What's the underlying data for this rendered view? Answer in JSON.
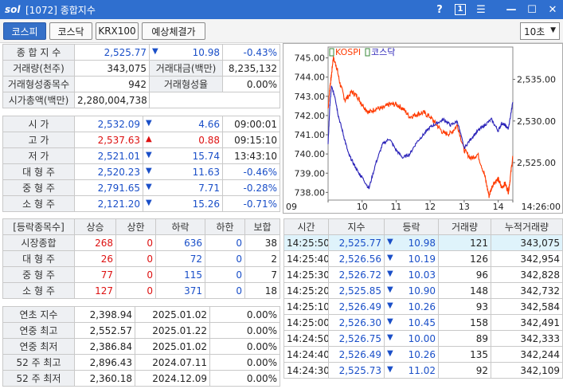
{
  "window": {
    "logo": "sol",
    "title": "[1072] 종합지수",
    "help": "?",
    "one": "1",
    "menu": "☰",
    "minimize": "—",
    "maximize": "☐",
    "close": "✕"
  },
  "toolbar": {
    "tabs": [
      "코스피",
      "코스닥",
      "KRX100",
      "예상체결가"
    ],
    "interval": "10초"
  },
  "summary": [
    {
      "c1": "종 합 지 수",
      "c2": "2,525.77",
      "c3": "▼",
      "c4": "10.98",
      "c5": "-0.43%"
    },
    {
      "c1": "거래량(천주)",
      "c2": "343,075",
      "c3": "거래대금(백만)",
      "c4": "8,235,132"
    },
    {
      "c1": "거래형성종목수",
      "c2": "942",
      "c3": "거래형성율",
      "c4": "0.00%"
    },
    {
      "c1": "시가총액(백만)",
      "c2": "2,280,004,738"
    }
  ],
  "prices": [
    {
      "label": "시      가",
      "value": "2,532.09",
      "dir": "▼",
      "change": "4.66",
      "extra": "09:00:01"
    },
    {
      "label": "고      가",
      "value": "2,537.63",
      "dir": "▲",
      "change": "0.88",
      "extra": "09:15:10"
    },
    {
      "label": "저      가",
      "value": "2,521.01",
      "dir": "▼",
      "change": "15.74",
      "extra": "13:43:10"
    },
    {
      "label": "대 형 주",
      "value": "2,520.23",
      "dir": "▼",
      "change": "11.63",
      "extra": "-0.46%"
    },
    {
      "label": "중 형 주",
      "value": "2,791.65",
      "dir": "▼",
      "change": "7.71",
      "extra": "-0.28%"
    },
    {
      "label": "소 형 주",
      "value": "2,121.20",
      "dir": "▼",
      "change": "15.26",
      "extra": "-0.71%"
    }
  ],
  "breadth": {
    "headers": [
      "[등락종목수]",
      "상승",
      "상한",
      "하락",
      "하한",
      "보합"
    ],
    "rows": [
      {
        "label": "시장종합",
        "up": "268",
        "limit_up": "0",
        "down": "636",
        "limit_down": "0",
        "flat": "38"
      },
      {
        "label": "대 형 주",
        "up": "26",
        "limit_up": "0",
        "down": "72",
        "limit_down": "0",
        "flat": "2"
      },
      {
        "label": "중 형 주",
        "up": "77",
        "limit_up": "0",
        "down": "115",
        "limit_down": "0",
        "flat": "7"
      },
      {
        "label": "소 형 주",
        "up": "127",
        "limit_up": "0",
        "down": "371",
        "limit_down": "0",
        "flat": "18"
      }
    ]
  },
  "extremes": [
    {
      "label": "연초  지수",
      "value": "2,398.94",
      "date": "2025.01.02",
      "pct": "0.00%"
    },
    {
      "label": "연중  최고",
      "value": "2,552.57",
      "date": "2025.01.22",
      "pct": "0.00%"
    },
    {
      "label": "연중  최저",
      "value": "2,386.84",
      "date": "2025.01.02",
      "pct": "0.00%"
    },
    {
      "label": "52 주 최고",
      "value": "2,896.43",
      "date": "2024.07.11",
      "pct": "0.00%"
    },
    {
      "label": "52 주 최저",
      "value": "2,360.18",
      "date": "2024.12.09",
      "pct": "0.00%"
    }
  ],
  "ticks": {
    "headers": [
      "시간",
      "지수",
      "등락",
      "거래량",
      "누적거래량"
    ],
    "rows": [
      {
        "time": "14:25:50",
        "index": "2,525.77",
        "dir": "▼",
        "change": "10.98",
        "vol": "121",
        "cum": "343,075"
      },
      {
        "time": "14:25:40",
        "index": "2,526.56",
        "dir": "▼",
        "change": "10.19",
        "vol": "126",
        "cum": "342,954"
      },
      {
        "time": "14:25:30",
        "index": "2,526.72",
        "dir": "▼",
        "change": "10.03",
        "vol": "96",
        "cum": "342,828"
      },
      {
        "time": "14:25:20",
        "index": "2,525.85",
        "dir": "▼",
        "change": "10.90",
        "vol": "148",
        "cum": "342,732"
      },
      {
        "time": "14:25:10",
        "index": "2,526.49",
        "dir": "▼",
        "change": "10.26",
        "vol": "93",
        "cum": "342,584"
      },
      {
        "time": "14:25:00",
        "index": "2,526.30",
        "dir": "▼",
        "change": "10.45",
        "vol": "158",
        "cum": "342,491"
      },
      {
        "time": "14:24:50",
        "index": "2,526.75",
        "dir": "▼",
        "change": "10.00",
        "vol": "89",
        "cum": "342,333"
      },
      {
        "time": "14:24:40",
        "index": "2,526.49",
        "dir": "▼",
        "change": "10.26",
        "vol": "135",
        "cum": "342,244"
      },
      {
        "time": "14:24:30",
        "index": "2,525.73",
        "dir": "▼",
        "change": "11.02",
        "vol": "92",
        "cum": "342,109"
      }
    ]
  },
  "colors": {
    "kospi": "#ff3a00",
    "kosdaq": "#2a22b8",
    "up": "#dd1111",
    "down": "#1a4fc8",
    "title_bar": "#2f6fcf"
  },
  "chart_data": {
    "type": "line",
    "legend": [
      "KOSPI",
      "코스닥"
    ],
    "legend_position": "top-left",
    "y_left_ticks": [
      "745.00",
      "744.00",
      "743.00",
      "742.00",
      "741.00",
      "740.00",
      "739.00",
      "738.00"
    ],
    "y_left_range": [
      737.6,
      745.4
    ],
    "y_right_ticks": [
      "2,535.00",
      "2,530.00",
      "2,525.00"
    ],
    "y_right_range": [
      2520.5,
      2538.5
    ],
    "x_ticks": [
      "09",
      "10",
      "11",
      "12",
      "13",
      "14",
      "14:26:00"
    ],
    "x_range": [
      9.0,
      14.43
    ],
    "series": [
      {
        "name": "KOSPI",
        "axis": "right",
        "x": [
          9.0,
          9.05,
          9.1,
          9.15,
          9.25,
          9.35,
          9.5,
          9.7,
          9.85,
          10.0,
          10.2,
          10.4,
          10.6,
          10.8,
          11.0,
          11.2,
          11.4,
          11.6,
          11.8,
          12.0,
          12.2,
          12.4,
          12.6,
          12.8,
          13.0,
          13.2,
          13.4,
          13.6,
          13.73,
          13.85,
          14.0,
          14.1,
          14.2,
          14.3,
          14.35,
          14.43
        ],
        "values": [
          2531.5,
          2534.0,
          2535.5,
          2537.6,
          2536.5,
          2534.5,
          2532.5,
          2533.5,
          2533.0,
          2532.0,
          2531.0,
          2531.5,
          2531.5,
          2532.0,
          2532.0,
          2531.5,
          2530.5,
          2530.8,
          2531.0,
          2530.5,
          2529.5,
          2528.5,
          2528.5,
          2529.5,
          2526.5,
          2525.5,
          2526.0,
          2523.5,
          2521.0,
          2522.5,
          2523.0,
          2522.0,
          2522.5,
          2521.5,
          2523.0,
          2525.8
        ]
      },
      {
        "name": "코스닥",
        "axis": "left",
        "x": [
          9.0,
          9.05,
          9.1,
          9.2,
          9.3,
          9.45,
          9.6,
          9.75,
          9.9,
          10.0,
          10.2,
          10.4,
          10.6,
          10.8,
          11.0,
          11.2,
          11.4,
          11.6,
          11.8,
          12.0,
          12.2,
          12.4,
          12.6,
          12.8,
          13.0,
          13.2,
          13.4,
          13.6,
          13.8,
          14.0,
          14.1,
          14.2,
          14.3,
          14.43
        ],
        "values": [
          740.5,
          742.5,
          743.5,
          743.0,
          742.0,
          741.0,
          740.0,
          739.5,
          739.0,
          738.8,
          738.2,
          739.5,
          740.5,
          740.8,
          740.2,
          739.8,
          740.0,
          740.6,
          741.0,
          741.4,
          741.6,
          741.8,
          741.5,
          741.7,
          740.3,
          740.8,
          741.2,
          741.5,
          741.8,
          741.2,
          741.6,
          741.5,
          741.3,
          742.7
        ]
      }
    ]
  }
}
